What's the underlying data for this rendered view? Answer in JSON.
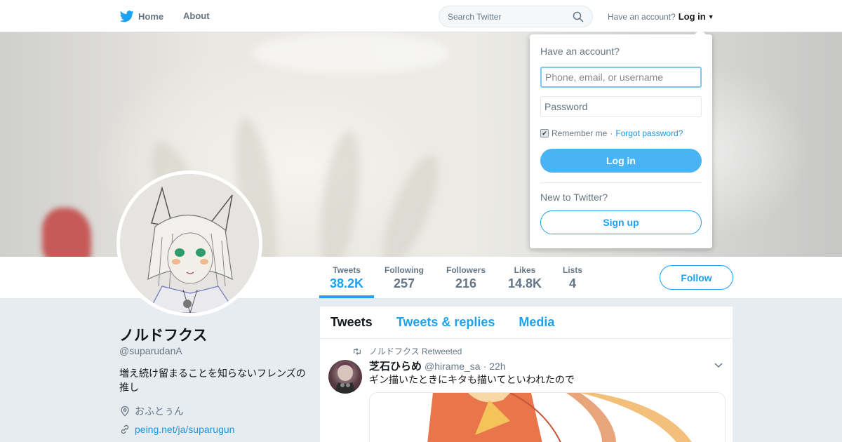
{
  "nav": {
    "home_label": "Home",
    "about_label": "About",
    "search_placeholder": "Search Twitter",
    "account_prompt": "Have an account?",
    "login_label": "Log in"
  },
  "profile": {
    "display_name": "ノルドフクス",
    "handle": "@suparudanA",
    "bio": "増え続け留まることを知らないフレンズの推し",
    "location": "おふとぅん",
    "website": "peing.net/ja/suparugun"
  },
  "stats": [
    {
      "label": "Tweets",
      "value": "38.2K"
    },
    {
      "label": "Following",
      "value": "257"
    },
    {
      "label": "Followers",
      "value": "216"
    },
    {
      "label": "Likes",
      "value": "14.8K"
    },
    {
      "label": "Lists",
      "value": "4"
    }
  ],
  "follow_label": "Follow",
  "timeline": {
    "tabs": [
      "Tweets",
      "Tweets & replies",
      "Media"
    ],
    "tweet": {
      "retweet_context": "ノルドフクス Retweeted",
      "author_name": "芝石ひらめ",
      "author_handle": "@hirame_sa",
      "time": "22h",
      "text": "ギン描いたときにキタも描いてといわれたので"
    }
  },
  "login_dropdown": {
    "title": "Have an account?",
    "username_placeholder": "Phone, email, or username",
    "password_placeholder": "Password",
    "remember_label": "Remember me",
    "separator": "·",
    "forgot_label": "Forgot password?",
    "login_button": "Log in",
    "new_prompt": "New to Twitter?",
    "signup_button": "Sign up"
  },
  "colors": {
    "brand_blue": "#1da1f2",
    "background": "#e6ecf0"
  }
}
